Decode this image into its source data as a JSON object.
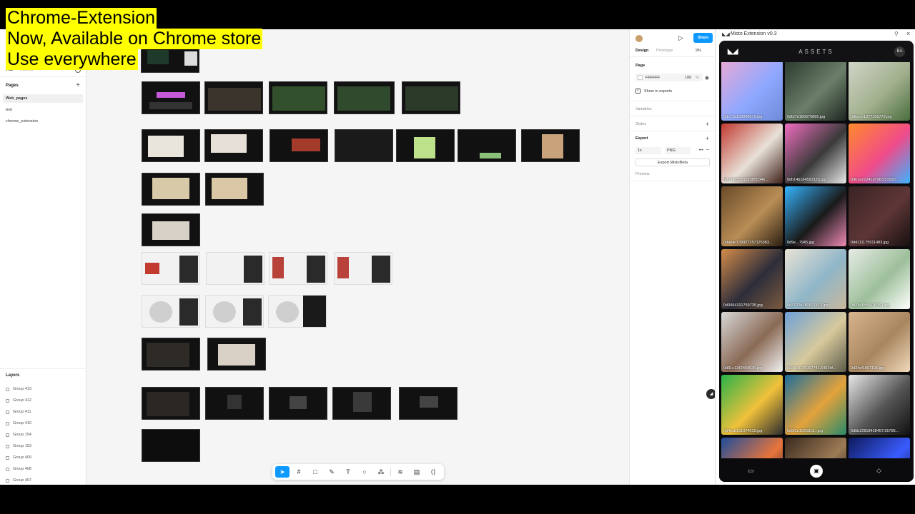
{
  "banner": {
    "line1": "Chrome-Extension",
    "line2": "Now, Available on Chrome store",
    "line3": "Use everywhere"
  },
  "left_panel": {
    "tab_file": "File",
    "tab_assets": "Assets",
    "pages_title": "Pages",
    "pages": [
      "Web_pages",
      "test",
      "chrome_extension"
    ],
    "layers_title": "Layers",
    "layers": [
      "Group 413",
      "Group 412",
      "Group 411",
      "Group 410",
      "Group 154",
      "Group 153",
      "Group 409",
      "Group 408",
      "Group 407"
    ]
  },
  "right_panel": {
    "share": "Share",
    "tab_design": "Design",
    "tab_prototype": "Prototype",
    "zoom": "9%",
    "page_title": "Page",
    "fill_hex": "FFFFFF",
    "fill_opacity": "100",
    "fill_unit": "%",
    "show_in_exports": "Show in exports",
    "variables": "Variables",
    "styles": "Styles",
    "export_title": "Export",
    "export_scale": "1x",
    "export_format": "PNG",
    "export_button": "Export MistoBeta",
    "preview": "Preview"
  },
  "extension": {
    "window_title": "Misto Extension v0.3",
    "header_title": "ASSETS",
    "avatar_initials": "BA",
    "assets": [
      {
        "name": "0dc71d189048079.jpg",
        "colors": [
          "#e7a9d6",
          "#8fa8ff",
          "#6e8bd8"
        ]
      },
      {
        "name": "0dbf7d185676889.jpg",
        "colors": [
          "#2b3a2e",
          "#6b7f6a",
          "#1e2620"
        ]
      },
      {
        "name": "0dbece1377108779.jpg",
        "colors": [
          "#cfd6c8",
          "#a3b08e",
          "#4a6e3e"
        ]
      },
      {
        "name": "0db3401551823855346...",
        "colors": [
          "#c23b32",
          "#e8e1d8",
          "#402018"
        ]
      },
      {
        "name": "0db14b164593125.jpg",
        "colors": [
          "#f06dbf",
          "#3a3a3a",
          "#e9e9e9"
        ]
      },
      {
        "name": "0db1e2124107983.61520...",
        "colors": [
          "#ff8a2b",
          "#f04b8a",
          "#3bb3ff"
        ]
      },
      {
        "name": "0da64c139927257125383...",
        "colors": [
          "#6a4b2a",
          "#b98d55",
          "#2a1e12"
        ]
      },
      {
        "name": "0d9e...7945.jpg",
        "colors": [
          "#36b4ff",
          "#1a1a1a",
          "#f08ab6"
        ]
      },
      {
        "name": "0d4111175911483.jpg",
        "colors": [
          "#3a2324",
          "#5e3637",
          "#181010"
        ]
      },
      {
        "name": "0d3494191759735.jpg",
        "colors": [
          "#d48c4a",
          "#2d2d3a",
          "#7a5a3f"
        ]
      },
      {
        "name": "0d3792b180507813.jpg",
        "colors": [
          "#e9e2d6",
          "#8fb6c8",
          "#c9b89c"
        ]
      },
      {
        "name": "0d33c1c84476953.jpg",
        "colors": [
          "#e6ebe6",
          "#9dbf9a",
          "#ffffff"
        ]
      },
      {
        "name": "0d31c1142464525.jpg",
        "colors": [
          "#d7d7d7",
          "#8a6a55",
          "#f2f2f2"
        ]
      },
      {
        "name": "0d37c0170067741.6457df...",
        "colors": [
          "#6ea1d8",
          "#d8c99c",
          "#5c5c4a"
        ]
      },
      {
        "name": "0d34ef1807105.jpg",
        "colors": [
          "#d8b48e",
          "#a8865f",
          "#f0d9bb"
        ]
      },
      {
        "name": "0d4ecb151074619.jpg",
        "colors": [
          "#29b34a",
          "#f0c13b",
          "#2d2d2d"
        ]
      },
      {
        "name": "0d5f2a1925813...jpg",
        "colors": [
          "#1d6e9c",
          "#e3a23c",
          "#2a8a6a"
        ]
      },
      {
        "name": "0d5b22818428457.55795...",
        "colors": [
          "#e8e8e8",
          "#555555",
          "#111111"
        ]
      },
      {
        "name": "",
        "colors": [
          "#1e4e9c",
          "#e8743b",
          "#1a1a2e"
        ]
      },
      {
        "name": "",
        "colors": [
          "#3a2a1e",
          "#9c7a55",
          "#151515"
        ]
      },
      {
        "name": "",
        "colors": [
          "#0e1a5c",
          "#3a5cff",
          "#0a0a1a"
        ]
      }
    ]
  },
  "colors": {
    "accent": "#0d99ff",
    "banner_bg": "#ffff00"
  }
}
